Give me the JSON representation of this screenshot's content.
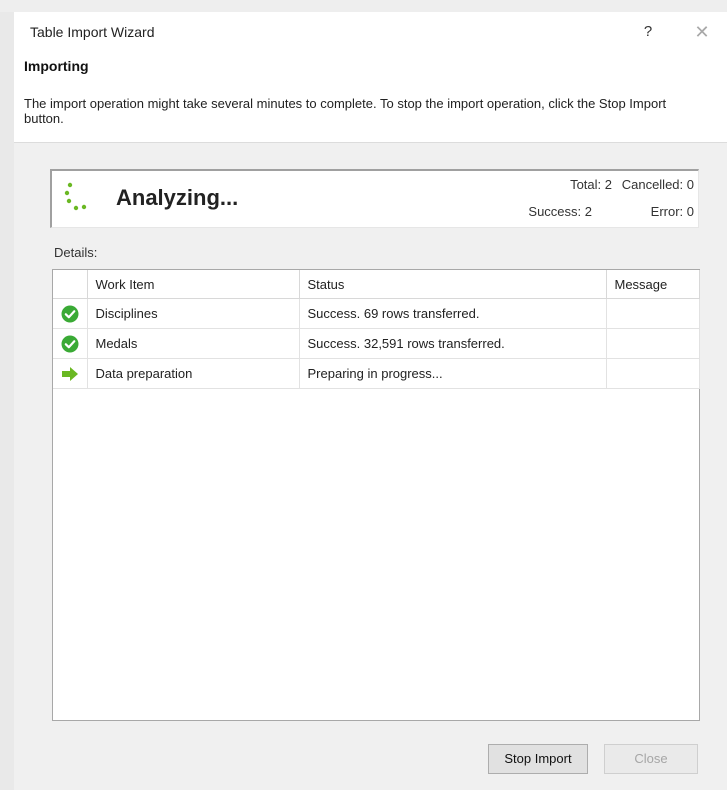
{
  "window": {
    "title": "Table Import Wizard",
    "help_label": "?",
    "close_label": "✕"
  },
  "header": {
    "title": "Importing",
    "description": "The import operation might take several minutes to complete. To stop the import operation, click the Stop Import button."
  },
  "status": {
    "state_text": "Analyzing...",
    "total": "Total: 2",
    "cancelled": "Cancelled: 0",
    "success": "Success: 2",
    "error": "Error: 0"
  },
  "details": {
    "label": "Details:",
    "columns": [
      "Work Item",
      "Status",
      "Message"
    ],
    "rows": [
      {
        "icon": "success-check-icon",
        "work_item": "Disciplines",
        "status": "Success. 69 rows transferred.",
        "message": ""
      },
      {
        "icon": "success-check-icon",
        "work_item": "Medals",
        "status": "Success. 32,591 rows transferred.",
        "message": ""
      },
      {
        "icon": "in-progress-arrow-icon",
        "work_item": "Data preparation",
        "status": "Preparing in progress...",
        "message": ""
      }
    ]
  },
  "buttons": {
    "stop_import": "Stop Import",
    "close": "Close"
  },
  "colors": {
    "success_green": "#3aaa35",
    "progress_green": "#6ab823",
    "dialog_bg": "#f0f0f0"
  }
}
